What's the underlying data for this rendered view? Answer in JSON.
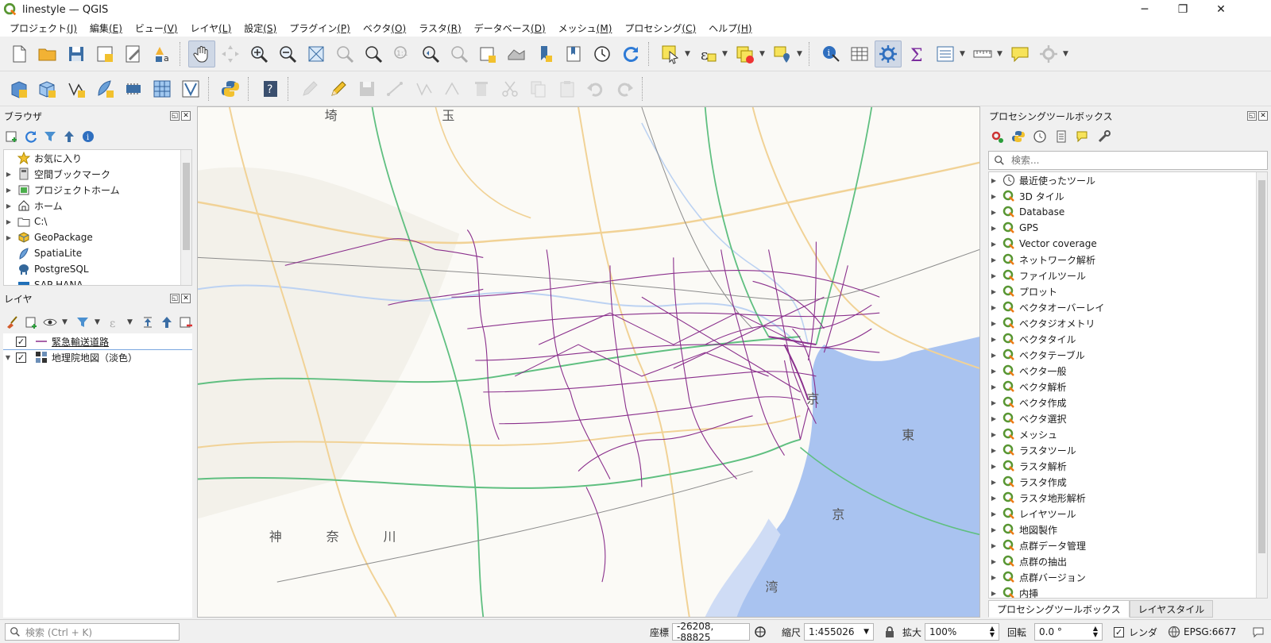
{
  "window": {
    "title": "linestyle — QGIS"
  },
  "menu": [
    {
      "label": "プロジェクト",
      "key": "(J)"
    },
    {
      "label": "編集",
      "key": "(E)"
    },
    {
      "label": "ビュー",
      "key": "(V)"
    },
    {
      "label": "レイヤ",
      "key": "(L)"
    },
    {
      "label": "設定",
      "key": "(S)"
    },
    {
      "label": "プラグイン",
      "key": "(P)"
    },
    {
      "label": "ベクタ",
      "key": "(O)"
    },
    {
      "label": "ラスタ",
      "key": "(R)"
    },
    {
      "label": "データベース",
      "key": "(D)"
    },
    {
      "label": "メッシュ",
      "key": "(M)"
    },
    {
      "label": "プロセシング",
      "key": "(C)"
    },
    {
      "label": "ヘルプ",
      "key": "(H)"
    }
  ],
  "browser": {
    "title": "ブラウザ",
    "items": [
      {
        "label": "お気に入り",
        "icon": "star-icon",
        "expand": false
      },
      {
        "label": "空間ブックマーク",
        "icon": "bookmark-icon",
        "expand": true
      },
      {
        "label": "プロジェクトホーム",
        "icon": "project-home-icon",
        "expand": true
      },
      {
        "label": "ホーム",
        "icon": "home-icon",
        "expand": true
      },
      {
        "label": "C:\\",
        "icon": "folder-icon",
        "expand": true
      },
      {
        "label": "GeoPackage",
        "icon": "geopackage-icon",
        "expand": true
      },
      {
        "label": "SpatiaLite",
        "icon": "spatialite-icon",
        "expand": false
      },
      {
        "label": "PostgreSQL",
        "icon": "postgresql-icon",
        "expand": false
      },
      {
        "label": "SAP HANA",
        "icon": "sap-hana-icon",
        "expand": false
      }
    ]
  },
  "layers": {
    "title": "レイヤ",
    "items": [
      {
        "label": "緊急輸送道路",
        "checked": true,
        "selected": true
      },
      {
        "label": "地理院地図（淡色）",
        "checked": true,
        "selected": false
      }
    ]
  },
  "map": {
    "labels": [
      {
        "text": "埼"
      },
      {
        "text": "玉"
      },
      {
        "text": "神"
      },
      {
        "text": "奈"
      },
      {
        "text": "川"
      },
      {
        "text": "東"
      },
      {
        "text": "京"
      },
      {
        "text": "京"
      },
      {
        "text": "湾"
      }
    ],
    "colors": {
      "land": "#fbfaf6",
      "water": "#a9c3f0",
      "road": "#8a2f8c",
      "green": "#5fbf80",
      "yellow": "#f1d296"
    }
  },
  "toolbox": {
    "title": "プロセシングツールボックス",
    "search_placeholder": "検索...",
    "items": [
      {
        "label": "最近使ったツール",
        "icon": "clock-icon"
      },
      {
        "label": "3D タイル",
        "icon": "qgis-icon"
      },
      {
        "label": "Database",
        "icon": "qgis-icon"
      },
      {
        "label": "GPS",
        "icon": "qgis-icon"
      },
      {
        "label": "Vector coverage",
        "icon": "qgis-icon"
      },
      {
        "label": "ネットワーク解析",
        "icon": "qgis-icon"
      },
      {
        "label": "ファイルツール",
        "icon": "qgis-icon"
      },
      {
        "label": "プロット",
        "icon": "qgis-icon"
      },
      {
        "label": "ベクタオーバーレイ",
        "icon": "qgis-icon"
      },
      {
        "label": "ベクタジオメトリ",
        "icon": "qgis-icon"
      },
      {
        "label": "ベクタタイル",
        "icon": "qgis-icon"
      },
      {
        "label": "ベクタテーブル",
        "icon": "qgis-icon"
      },
      {
        "label": "ベクタ一般",
        "icon": "qgis-icon"
      },
      {
        "label": "ベクタ解析",
        "icon": "qgis-icon"
      },
      {
        "label": "ベクタ作成",
        "icon": "qgis-icon"
      },
      {
        "label": "ベクタ選択",
        "icon": "qgis-icon"
      },
      {
        "label": "メッシュ",
        "icon": "qgis-icon"
      },
      {
        "label": "ラスタツール",
        "icon": "qgis-icon"
      },
      {
        "label": "ラスタ解析",
        "icon": "qgis-icon"
      },
      {
        "label": "ラスタ作成",
        "icon": "qgis-icon"
      },
      {
        "label": "ラスタ地形解析",
        "icon": "qgis-icon"
      },
      {
        "label": "レイヤツール",
        "icon": "qgis-icon"
      },
      {
        "label": "地図製作",
        "icon": "qgis-icon"
      },
      {
        "label": "点群データ管理",
        "icon": "qgis-icon"
      },
      {
        "label": "点群の抽出",
        "icon": "qgis-icon"
      },
      {
        "label": "点群バージョン",
        "icon": "qgis-icon"
      },
      {
        "label": "内挿",
        "icon": "qgis-icon"
      }
    ],
    "tabs": [
      "プロセシングツールボックス",
      "レイヤスタイル"
    ]
  },
  "status": {
    "search_placeholder": "検索 (Ctrl + K)",
    "coord_label": "座標",
    "coord_value": "-26208, -88825",
    "scale_label": "縮尺",
    "scale_value": "1:455026",
    "mag_label": "拡大",
    "mag_value": "100%",
    "rot_label": "回転",
    "rot_value": "0.0 °",
    "render_label": "レンダ",
    "crs": "EPSG:6677"
  }
}
